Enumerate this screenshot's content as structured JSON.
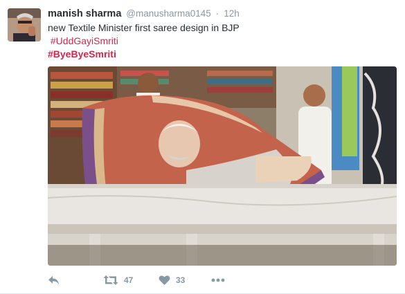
{
  "tweet": {
    "author_name": "manish sharma",
    "author_handle": "@manusharma0145",
    "separator": "·",
    "time": "12h",
    "text_line": "new Textile Minister first saree design in BJP",
    "hashtag_1": "#UddGayiSmriti",
    "hashtag_2": "#ByeByeSmriti"
  },
  "actions": {
    "reply_icon": "reply-icon",
    "retweet_icon": "retweet-icon",
    "retweet_count": "47",
    "like_icon": "heart-icon",
    "like_count": "33",
    "more_icon": "more-dots-icon"
  },
  "colors": {
    "hashtag": "#d5264b",
    "muted": "#8899a6",
    "text": "#292f33"
  }
}
